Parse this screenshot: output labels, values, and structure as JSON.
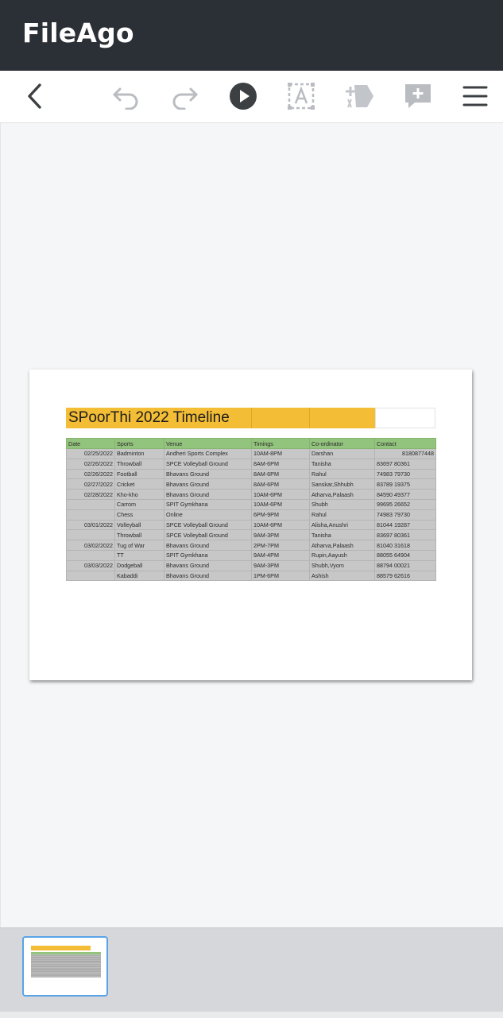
{
  "app": {
    "title": "FileAgo"
  },
  "toolbar": {
    "icons": [
      "back-icon",
      "undo-icon",
      "redo-icon",
      "play-icon",
      "text-select-icon",
      "stamp-icon",
      "add-comment-icon",
      "menu-icon"
    ]
  },
  "document": {
    "sheet_title": "SPoorThi 2022 Timeline",
    "headers": [
      "Date",
      "Sports",
      "Venue",
      "Timings",
      "Co-ordinator",
      "Contact"
    ],
    "rows": [
      [
        "02/25/2022",
        "Badminton",
        "Andheri Sports Complex",
        "10AM-8PM",
        "Darshan",
        "8180877448"
      ],
      [
        "02/26/2022",
        "Throwball",
        "SPCE Volleyball Ground",
        "8AM-6PM",
        "Tanisha",
        "83697 80361"
      ],
      [
        "02/26/2022",
        "Football",
        "Bhavans Ground",
        "8AM-6PM",
        "Rahul",
        "74983 79730"
      ],
      [
        "02/27/2022",
        "Cricket",
        "Bhavans Ground",
        "8AM-6PM",
        "Sanskar,Shhubh",
        "83789 19375"
      ],
      [
        "02/28/2022",
        "Kho-kho",
        "Bhavans Ground",
        "10AM-6PM",
        "Atharva,Palaash",
        "84590 49377"
      ],
      [
        "",
        "Carrom",
        "SPIT Gymkhana",
        "10AM-6PM",
        "Shubh",
        "99695 26652"
      ],
      [
        "",
        "Chess",
        "Online",
        "6PM-9PM",
        "Rahul",
        "74983 79730"
      ],
      [
        "03/01/2022",
        "Volleyball",
        "SPCE Volleyball Ground",
        "10AM-6PM",
        "Alisha,Anushri",
        "81044 19287"
      ],
      [
        "",
        "Throwball",
        "SPCE Volleyball Ground",
        "9AM-3PM",
        "Tanisha",
        "83697 80361"
      ],
      [
        "03/02/2022",
        "Tug of War",
        "Bhavans Ground",
        "2PM-7PM",
        "Atharva,Palaash",
        "81040 31618"
      ],
      [
        "",
        "TT",
        "SPIT Gymkhana",
        "9AM-4PM",
        "Rupin,Aayush",
        "88055 64904"
      ],
      [
        "03/03/2022",
        "Dodgeball",
        "Bhavans Ground",
        "9AM-3PM",
        "Shubh,Vyom",
        "88794 00021"
      ],
      [
        "",
        "Kabaddi",
        "Bhavans Ground",
        "1PM-6PM",
        "Ashish",
        "88579 62616"
      ]
    ]
  },
  "colors": {
    "appbar": "#2b2f36",
    "title_fill": "#f3bd35",
    "header_fill": "#93c47d",
    "row_fill": "#c7c7c7",
    "thumb_border": "#5aa3e8"
  }
}
